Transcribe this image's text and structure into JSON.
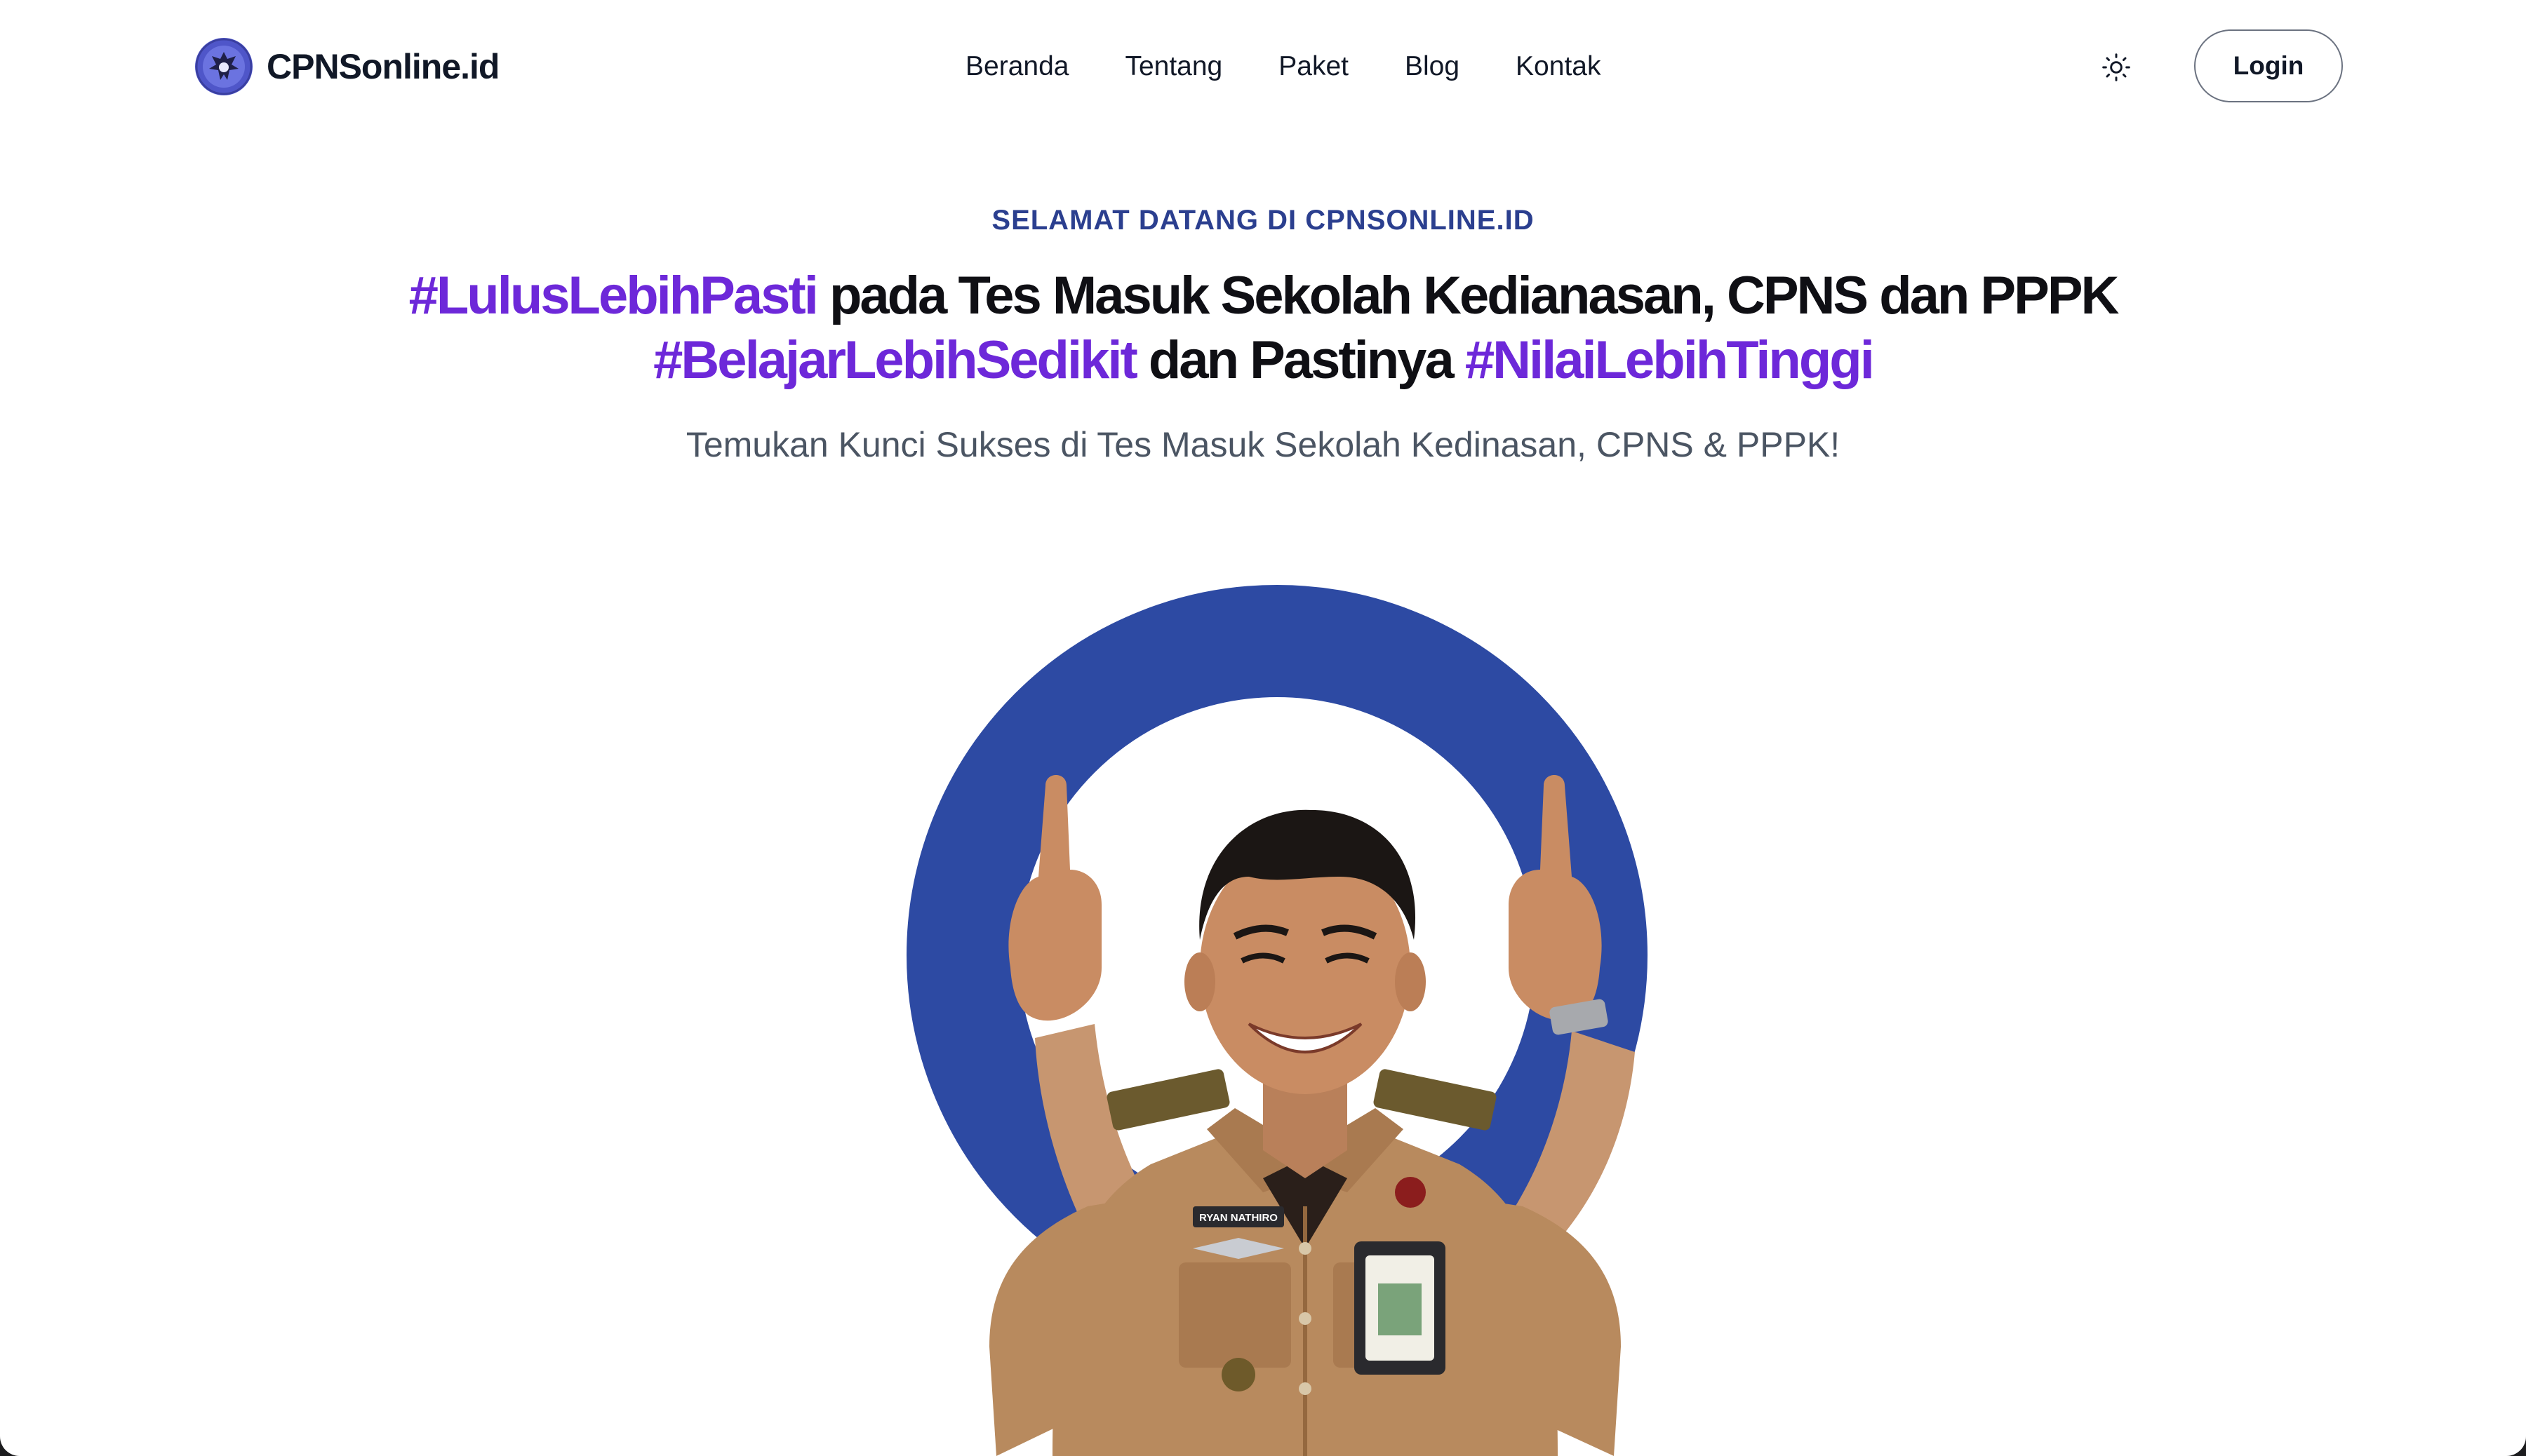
{
  "brand": {
    "name": "CPNSonline.id"
  },
  "nav": {
    "items": [
      {
        "label": "Beranda"
      },
      {
        "label": "Tentang"
      },
      {
        "label": "Paket"
      },
      {
        "label": "Blog"
      },
      {
        "label": "Kontak"
      }
    ]
  },
  "header": {
    "theme_icon": "sun-icon",
    "login_label": "Login"
  },
  "hero": {
    "eyebrow": "SELAMAT DATANG DI CPNSONLINE.ID",
    "line1_hashtag": "#LulusLebihPasti",
    "line1_text": " pada Tes Masuk Sekolah Kedianasan, CPNS dan PPPK",
    "line2_hashtag1": "#BelajarLebihSedikit",
    "line2_text": " dan Pastinya ",
    "line2_hashtag2": "#NilaiLebihTinggi",
    "subtitle": "Temukan Kunci Sukses di Tes Masuk Sekolah Kedinasan, CPNS & PPPK!",
    "name_tag": "RYAN NATHIRO"
  },
  "colors": {
    "accent_purple": "#6d28d9",
    "brand_blue": "#2d4aa3",
    "eyebrow_blue": "#2b3f8f",
    "uniform_khaki": "#b88a5e"
  }
}
